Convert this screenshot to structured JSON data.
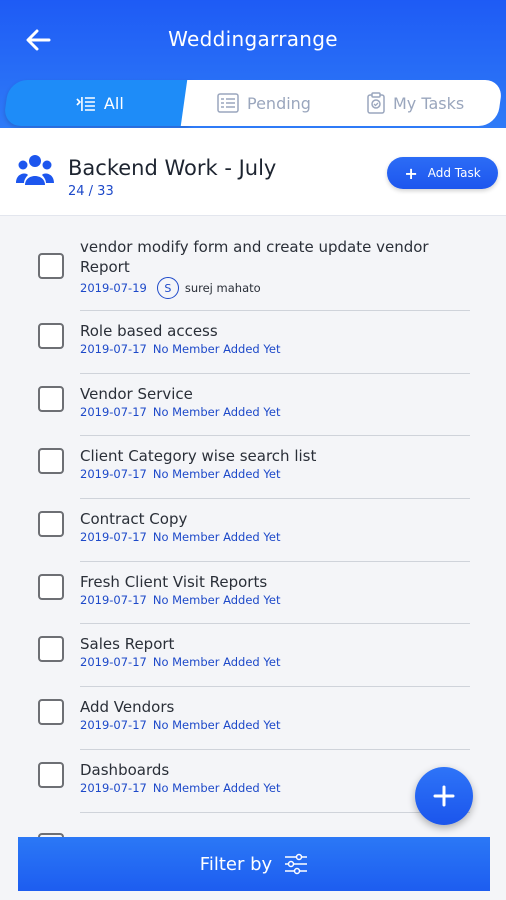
{
  "header": {
    "title": "Weddingarrange"
  },
  "tabs": [
    {
      "label": "All",
      "icon": "list-icon",
      "active": true
    },
    {
      "label": "Pending",
      "icon": "checklist-icon",
      "active": false
    },
    {
      "label": "My Tasks",
      "icon": "clipboard-icon",
      "active": false
    }
  ],
  "project": {
    "title": "Backend Work - July",
    "count": "24 / 33",
    "add_task_label": "Add Task"
  },
  "tasks": [
    {
      "name": "vendor modify form and create update vendor Report",
      "date": "2019-07-19",
      "avatar": "S",
      "member": "surej mahato"
    },
    {
      "name": "Role based access",
      "date": "2019-07-17",
      "member": "No Member Added Yet"
    },
    {
      "name": "Vendor Service",
      "date": "2019-07-17",
      "member": "No Member Added Yet"
    },
    {
      "name": "Client Category wise search list",
      "date": "2019-07-17",
      "member": "No Member Added Yet"
    },
    {
      "name": "Contract Copy",
      "date": "2019-07-17",
      "member": "No Member Added Yet"
    },
    {
      "name": "Fresh Client Visit Reports",
      "date": "2019-07-17",
      "member": "No Member Added Yet"
    },
    {
      "name": "Sales Report",
      "date": "2019-07-17",
      "member": "No Member Added Yet"
    },
    {
      "name": "Add Vendors",
      "date": "2019-07-17",
      "member": "No Member Added Yet"
    },
    {
      "name": "Dashboards",
      "date": "2019-07-17",
      "member": "No Member Added Yet"
    }
  ],
  "fab": {
    "label": "+"
  },
  "filter": {
    "label": "Filter by"
  },
  "colors": {
    "primary": "#1e5bf5",
    "accent_text": "#1d49c9"
  }
}
